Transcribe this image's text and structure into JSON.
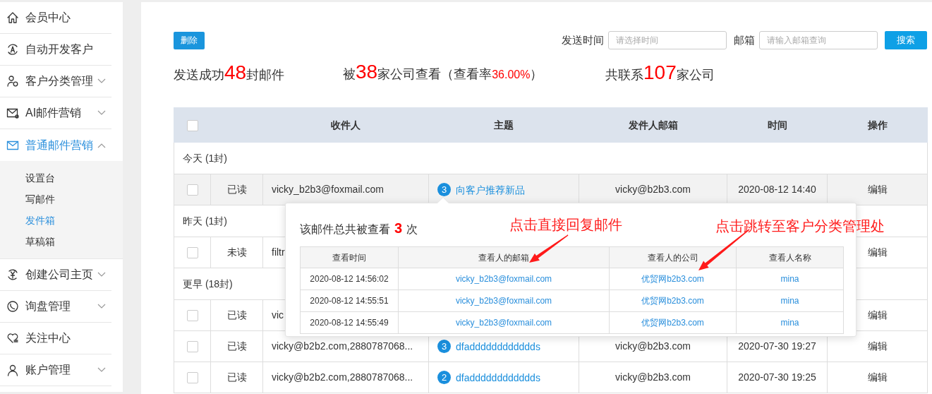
{
  "sidebar": {
    "items": [
      {
        "label": "会员中心",
        "kind": "link",
        "selected": false
      },
      {
        "label": "自动开发客户",
        "kind": "link",
        "selected": false
      },
      {
        "label": "客户分类管理",
        "kind": "menu",
        "expanded": false,
        "selected": false
      },
      {
        "label": "AI邮件营销",
        "kind": "menu",
        "expanded": false,
        "selected": false
      },
      {
        "label": "普通邮件营销",
        "kind": "menu",
        "expanded": true,
        "selected": true,
        "children": [
          {
            "label": "设置台",
            "selected": false
          },
          {
            "label": "写邮件",
            "selected": false
          },
          {
            "label": "发件箱",
            "selected": true
          },
          {
            "label": "草稿箱",
            "selected": false
          }
        ]
      },
      {
        "label": "创建公司主页",
        "kind": "menu",
        "expanded": false,
        "selected": false
      },
      {
        "label": "询盘管理",
        "kind": "menu",
        "expanded": false,
        "selected": false
      },
      {
        "label": "关注中心",
        "kind": "link",
        "selected": false
      },
      {
        "label": "账户管理",
        "kind": "menu",
        "expanded": false,
        "selected": false
      }
    ]
  },
  "toolbar": {
    "delete_button": "删除",
    "send_time": {
      "label": "发送时间",
      "placeholder": "请选择时间"
    },
    "mailbox": {
      "label": "邮箱",
      "placeholder": "请输入邮箱查询"
    },
    "search_button": "搜索"
  },
  "stats": [
    {
      "parts": [
        {
          "text": "发送成功",
          "kind": "plain"
        },
        {
          "text": "48",
          "kind": "number"
        },
        {
          "text": "封邮件",
          "kind": "plain"
        }
      ]
    },
    {
      "parts": [
        {
          "text": "被",
          "kind": "plain"
        },
        {
          "text": "38",
          "kind": "number"
        },
        {
          "text": "家公司查看（查看率",
          "kind": "plain"
        },
        {
          "text": "36.00%",
          "kind": "rate"
        },
        {
          "text": "）",
          "kind": "plain"
        }
      ]
    },
    {
      "parts": [
        {
          "text": "共联系",
          "kind": "plain"
        },
        {
          "text": "107",
          "kind": "number"
        },
        {
          "text": "家公司",
          "kind": "plain"
        }
      ]
    }
  ],
  "table": {
    "select_all": {
      "checked": false
    },
    "columns": [
      "收件人",
      "主题",
      "发件人邮箱",
      "时间",
      "操作"
    ],
    "groups": [
      {
        "label": "今天 (1封)",
        "rows": [
          {
            "checked": false,
            "highlighted": true,
            "status": "已读",
            "recipient": "vicky_b2b3@foxmail.com",
            "count": "3",
            "subject": "向客户推荐新品",
            "sender": "vicky@b2b3.com",
            "time": "2020-08-12 14:40",
            "action": "编辑"
          }
        ]
      },
      {
        "label": "昨天 (1封)",
        "rows": [
          {
            "checked": false,
            "highlighted": false,
            "status": "未读",
            "recipient": "filtr",
            "action": "编辑"
          }
        ]
      },
      {
        "label": "更早 (18封)",
        "rows": [
          {
            "checked": false,
            "highlighted": false,
            "status": "已读",
            "recipient": "vic",
            "action": "编辑"
          },
          {
            "checked": false,
            "highlighted": false,
            "status": "已读",
            "recipient": "vicky@b2b2.com,2880787068...",
            "count": "3",
            "subject": "dfadddddddddddds",
            "sender": "vicky@b2b3.com",
            "time": "2020-07-30 19:27",
            "action": "编辑"
          },
          {
            "checked": false,
            "highlighted": false,
            "status": "已读",
            "recipient": "vicky@b2b2.com,2880787068...",
            "count": "2",
            "subject": "dfadddddddddddds",
            "sender": "vicky@b2b3.com",
            "time": "2020-07-30 19:25",
            "action": "编辑"
          }
        ]
      }
    ]
  },
  "popover": {
    "title_parts": [
      {
        "text": "该邮件总共被查看",
        "kind": "plain"
      },
      {
        "text": "3",
        "kind": "number"
      },
      {
        "text": "次",
        "kind": "plain"
      }
    ],
    "columns": [
      "查看时间",
      "查看人的邮箱",
      "查看人的公司",
      "查看人名称"
    ],
    "rows": [
      [
        "2020-08-12 14:56:02",
        "vicky_b2b3@foxmail.com",
        "优贸网b2b3.com",
        "mina"
      ],
      [
        "2020-08-12 14:55:51",
        "vicky_b2b3@foxmail.com",
        "优贸网b2b3.com",
        "mina"
      ],
      [
        "2020-08-12 14:55:49",
        "vicky_b2b3@foxmail.com",
        "优贸网b2b3.com",
        "mina"
      ]
    ]
  },
  "annotations": [
    "点击直接回复邮件",
    "点击跳转至客户分类管理处"
  ]
}
